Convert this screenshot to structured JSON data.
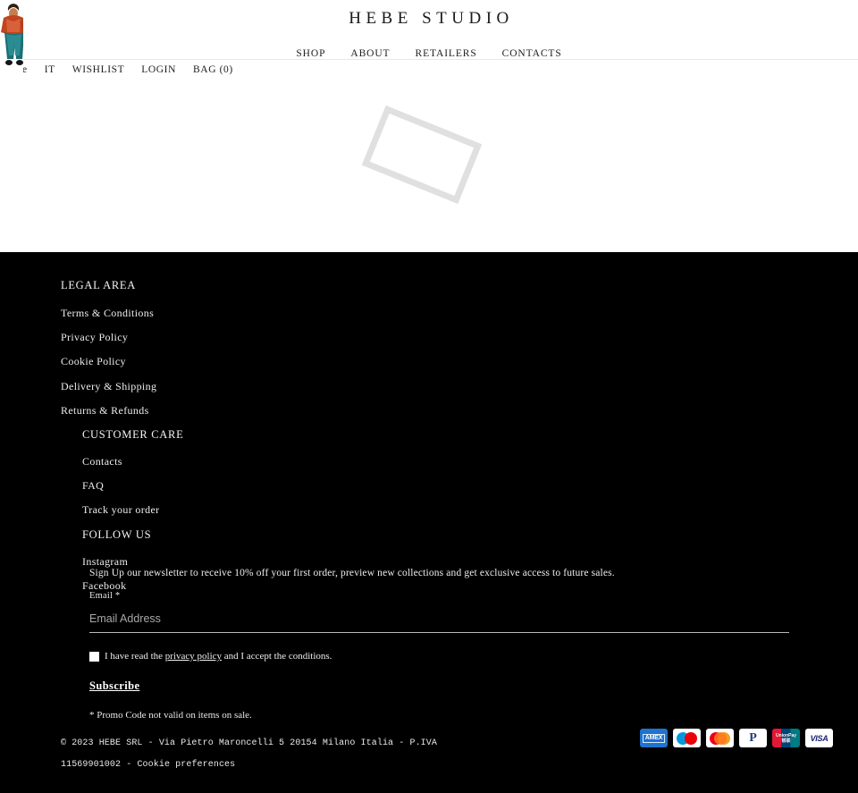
{
  "header": {
    "logo": "HEBE STUDIO",
    "nav": [
      {
        "label": "SHOP"
      },
      {
        "label": "ABOUT"
      },
      {
        "label": "RETAILERS"
      },
      {
        "label": "CONTACTS"
      }
    ]
  },
  "utility_bar": {
    "truncated_text": "e",
    "items": [
      {
        "label": "IT"
      },
      {
        "label": "WISHLIST"
      },
      {
        "label": "LOGIN"
      },
      {
        "label": "BAG (0)"
      }
    ]
  },
  "main": {
    "placeholder_icon": "broken-image-icon"
  },
  "footer": {
    "legal": {
      "heading": "LEGAL AREA",
      "links": [
        {
          "label": "Terms & Conditions"
        },
        {
          "label": "Privacy Policy"
        },
        {
          "label": "Cookie Policy"
        },
        {
          "label": "Delivery & Shipping"
        },
        {
          "label": "Returns & Refunds"
        }
      ]
    },
    "customer_care": {
      "heading": "CUSTOMER CARE",
      "links": [
        {
          "label": "Contacts"
        },
        {
          "label": "FAQ"
        },
        {
          "label": "Track your order"
        }
      ]
    },
    "follow_us": {
      "heading": "FOLLOW US",
      "links": [
        {
          "label": "Instagram"
        },
        {
          "label": "Facebook"
        }
      ]
    },
    "newsletter": {
      "intro": "Sign Up our newsletter to receive 10% off your first order, preview new collections and get exclusive access to future sales.",
      "email_label": "Email *",
      "email_placeholder": "Email Address",
      "email_value": "",
      "consent_pre": "I have read the ",
      "consent_link": "privacy policy",
      "consent_post": " and I accept the conditions.",
      "consent_checked": false,
      "subscribe_label": "Subscribe",
      "promo_note": "* Promo Code not valid on items on sale."
    },
    "bottom": {
      "copyright_line1": "© 2023 HEBE SRL - Via Pietro Maroncelli 5 20154 Milano Italia - P.IVA",
      "copyright_line2_number": "11569901002",
      "copyright_separator": " -  ",
      "cookie_preferences": "Cookie preferences"
    },
    "payments": [
      {
        "name": "amex",
        "label": "AMEX"
      },
      {
        "name": "maestro",
        "label": "Maestro"
      },
      {
        "name": "mastercard",
        "label": "Mastercard"
      },
      {
        "name": "paypal",
        "label": "PayPal"
      },
      {
        "name": "unionpay",
        "label_top": "UnionPay",
        "label_bottom": "银联"
      },
      {
        "name": "visa",
        "label": "VISA"
      }
    ]
  },
  "colors": {
    "footer_bg": "#000000",
    "page_bg": "#ffffff",
    "text_dark": "#1b1b1b",
    "text_light": "#f2f2f2",
    "placeholder_border": "#e0e0e0"
  }
}
